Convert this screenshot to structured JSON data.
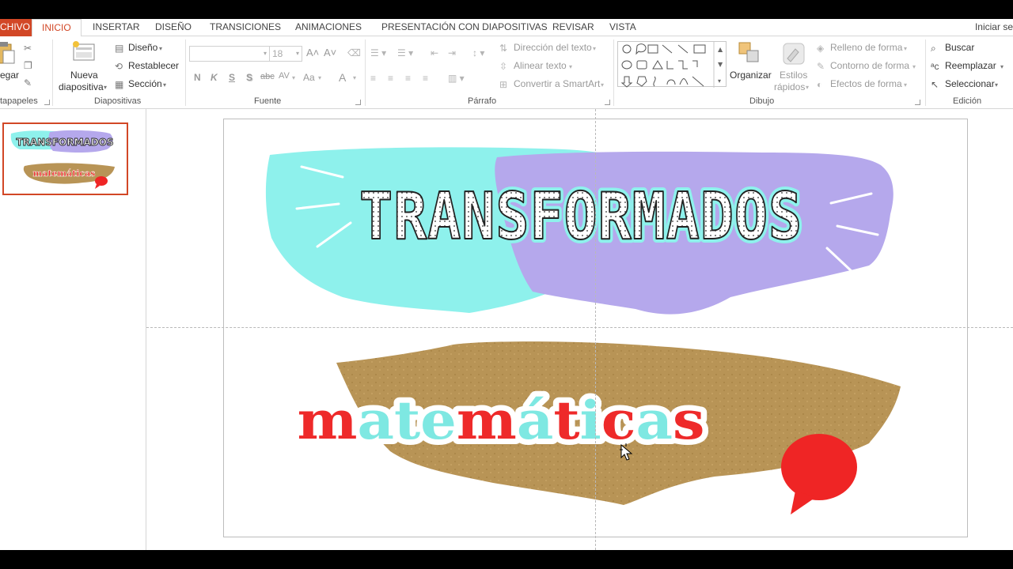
{
  "ribbon_tabs": {
    "file": "CHIVO",
    "active": "INICIO",
    "tabs": [
      "INSERTAR",
      "DISEÑO",
      "TRANSICIONES",
      "ANIMACIONES",
      "PRESENTACIÓN CON DIAPOSITIVAS",
      "REVISAR",
      "VISTA"
    ],
    "signin": "Iniciar se"
  },
  "clipboard": {
    "paste_label": "egar",
    "group_label": "tapapeles"
  },
  "slides_group": {
    "new_slide_line1": "Nueva",
    "new_slide_line2": "diapositiva",
    "layout": "Diseño",
    "reset": "Restablecer",
    "section": "Sección",
    "group_label": "Diapositivas"
  },
  "font_group": {
    "font_name": "",
    "font_size": "18",
    "bold": "N",
    "italic": "K",
    "underline": "S",
    "shadow": "S",
    "strike": "abc",
    "spacing": "AV",
    "case": "Aa",
    "color": "A",
    "group_label": "Fuente"
  },
  "paragraph_group": {
    "text_direction": "Dirección del texto",
    "align_text": "Alinear texto",
    "smartart": "Convertir a SmartArt",
    "group_label": "Párrafo"
  },
  "drawing_group": {
    "arrange": "Organizar",
    "quick_styles_1": "Estilos",
    "quick_styles_2": "rápidos",
    "shape_fill": "Relleno de forma",
    "shape_outline": "Contorno de forma",
    "shape_effects": "Efectos de forma",
    "group_label": "Dibujo"
  },
  "editing_group": {
    "find": "Buscar",
    "replace": "Reemplazar",
    "select": "Seleccionar",
    "group_label": "Edición"
  },
  "slide": {
    "title": "TRANSFORMADOS",
    "subtitle_letters": [
      {
        "ch": "m",
        "color": "#ee2a2a"
      },
      {
        "ch": "a",
        "color": "#7ee8e2"
      },
      {
        "ch": "t",
        "color": "#7ee8e2"
      },
      {
        "ch": "e",
        "color": "#7ee8e2"
      },
      {
        "ch": "m",
        "color": "#ee2a2a"
      },
      {
        "ch": "á",
        "color": "#7ee8e2"
      },
      {
        "ch": "t",
        "color": "#ee2a2a"
      },
      {
        "ch": "i",
        "color": "#7ee8e2"
      },
      {
        "ch": "c",
        "color": "#ee2a2a"
      },
      {
        "ch": "a",
        "color": "#7ee8e2"
      },
      {
        "ch": "s",
        "color": "#ee2a2a"
      }
    ],
    "colors": {
      "cyan_paper": "#8ef1ec",
      "purple_paper": "#b5a8ec",
      "brown_paper": "#b89456",
      "speech_bubble": "#ef2525",
      "accent_orange": "#d24726"
    }
  },
  "thumbnail": {
    "title": "TRANSFORMADOS",
    "subtitle": "matemáticas"
  }
}
